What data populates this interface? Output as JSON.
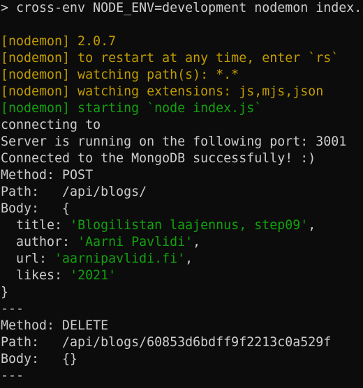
{
  "terminal": {
    "colors": {
      "background": "#0c0c0c",
      "default": "#cccccc",
      "yellow": "#c19c00",
      "green": "#13a10e"
    },
    "lines": [
      {
        "row": 0,
        "segments": [
          {
            "text": "> cross-env NODE_ENV=development nodemon index.js",
            "color": "default"
          }
        ]
      },
      {
        "row": 2,
        "segments": [
          {
            "text": "[nodemon] 2.0.7",
            "color": "yellow"
          }
        ]
      },
      {
        "row": 3,
        "segments": [
          {
            "text": "[nodemon] to restart at any time, enter `rs`",
            "color": "yellow"
          }
        ]
      },
      {
        "row": 4,
        "segments": [
          {
            "text": "[nodemon] watching path(s): *.*",
            "color": "yellow"
          }
        ]
      },
      {
        "row": 5,
        "segments": [
          {
            "text": "[nodemon] watching extensions: js,mjs,json",
            "color": "yellow"
          }
        ]
      },
      {
        "row": 6,
        "segments": [
          {
            "text": "[nodemon] starting `node index.js`",
            "color": "green"
          }
        ]
      },
      {
        "row": 7,
        "segments": [
          {
            "text": "connecting to",
            "color": "default"
          }
        ]
      },
      {
        "row": 8,
        "segments": [
          {
            "text": "Server is running on the following port: 3001",
            "color": "default"
          }
        ]
      },
      {
        "row": 9,
        "segments": [
          {
            "text": "Connected to the MongoDB successfully! :)",
            "color": "default"
          }
        ]
      },
      {
        "row": 10,
        "segments": [
          {
            "text": "Method: POST",
            "color": "default"
          }
        ]
      },
      {
        "row": 11,
        "segments": [
          {
            "text": "Path:   /api/blogs/",
            "color": "default"
          }
        ]
      },
      {
        "row": 12,
        "segments": [
          {
            "text": "Body:   {",
            "color": "default"
          }
        ]
      },
      {
        "row": 13,
        "segments": [
          {
            "text": "  title: ",
            "color": "default"
          },
          {
            "text": "'Blogilistan laajennus, step09'",
            "color": "green"
          },
          {
            "text": ",",
            "color": "default"
          }
        ]
      },
      {
        "row": 14,
        "segments": [
          {
            "text": "  author: ",
            "color": "default"
          },
          {
            "text": "'Aarni Pavlidi'",
            "color": "green"
          },
          {
            "text": ",",
            "color": "default"
          }
        ]
      },
      {
        "row": 15,
        "segments": [
          {
            "text": "  url: ",
            "color": "default"
          },
          {
            "text": "'aarnipavlidi.fi'",
            "color": "green"
          },
          {
            "text": ",",
            "color": "default"
          }
        ]
      },
      {
        "row": 16,
        "segments": [
          {
            "text": "  likes: ",
            "color": "default"
          },
          {
            "text": "'2021'",
            "color": "green"
          }
        ]
      },
      {
        "row": 17,
        "segments": [
          {
            "text": "}",
            "color": "default"
          }
        ]
      },
      {
        "row": 18,
        "segments": [
          {
            "text": "---",
            "color": "default"
          }
        ]
      },
      {
        "row": 19,
        "segments": [
          {
            "text": "Method: DELETE",
            "color": "default"
          }
        ]
      },
      {
        "row": 20,
        "segments": [
          {
            "text": "Path:   /api/blogs/60853d6bdff9f2213c0a529f",
            "color": "default"
          }
        ]
      },
      {
        "row": 21,
        "segments": [
          {
            "text": "Body:   {}",
            "color": "default"
          }
        ]
      },
      {
        "row": 22,
        "segments": [
          {
            "text": "---",
            "color": "default"
          }
        ]
      }
    ]
  }
}
